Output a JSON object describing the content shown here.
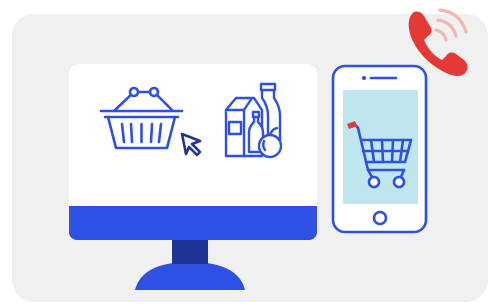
{
  "colors": {
    "background": "#ffffff",
    "panel": "#f0f0f0",
    "primary_blue": "#2f50e4",
    "dark_blue": "#1f3596",
    "phone_screen": "#bfe6ee",
    "accent_red": "#e53935",
    "white": "#ffffff"
  },
  "icons": {
    "phone_call": "phone-ringing-icon",
    "basket": "shopping-basket-icon",
    "cursor": "mouse-cursor-icon",
    "groceries": "groceries-icon",
    "cart": "shopping-cart-icon"
  }
}
